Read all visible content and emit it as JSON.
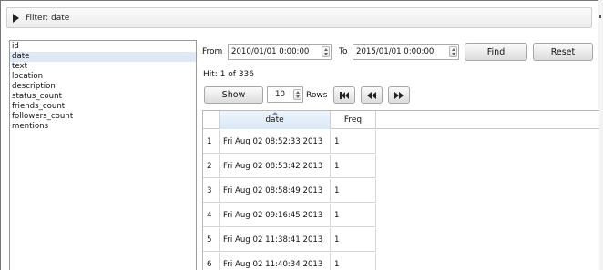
{
  "filter": {
    "title": "Filter: date"
  },
  "fields": {
    "items": [
      "id",
      "date",
      "text",
      "location",
      "description",
      "status_count",
      "friends_count",
      "followers_count",
      "mentions"
    ],
    "selected": "date"
  },
  "range": {
    "from_label": "From",
    "from_value": "2010/01/01 0:00:00",
    "to_label": "To",
    "to_value": "2015/01/01 0:00:00",
    "find_label": "Find",
    "reset_label": "Reset"
  },
  "hit": {
    "text": "Hit: 1  of 336"
  },
  "paging": {
    "show_label": "Show",
    "rows_value": "10",
    "rows_label": "Rows",
    "first_icon": "skip-first-icon",
    "prev_icon": "rewind-icon",
    "next_icon": "fast-forward-icon"
  },
  "table": {
    "columns": [
      "",
      "date",
      "Freq"
    ],
    "sorted_column": "date",
    "rows": [
      {
        "index": "1",
        "date": "Fri Aug 02 08:52:33  2013",
        "freq": "1"
      },
      {
        "index": "2",
        "date": "Fri Aug 02 08:53:42  2013",
        "freq": "1"
      },
      {
        "index": "3",
        "date": "Fri Aug 02 08:58:49  2013",
        "freq": "1"
      },
      {
        "index": "4",
        "date": "Fri Aug 02 09:16:45  2013",
        "freq": "1"
      },
      {
        "index": "5",
        "date": "Fri Aug 02 11:38:41  2013",
        "freq": "1"
      },
      {
        "index": "6",
        "date": "Fri Aug 02 11:40:34  2013",
        "freq": "1"
      }
    ]
  },
  "colors": {
    "selection": "#dfe9f5",
    "header_sorted": "#d9e8f7"
  }
}
